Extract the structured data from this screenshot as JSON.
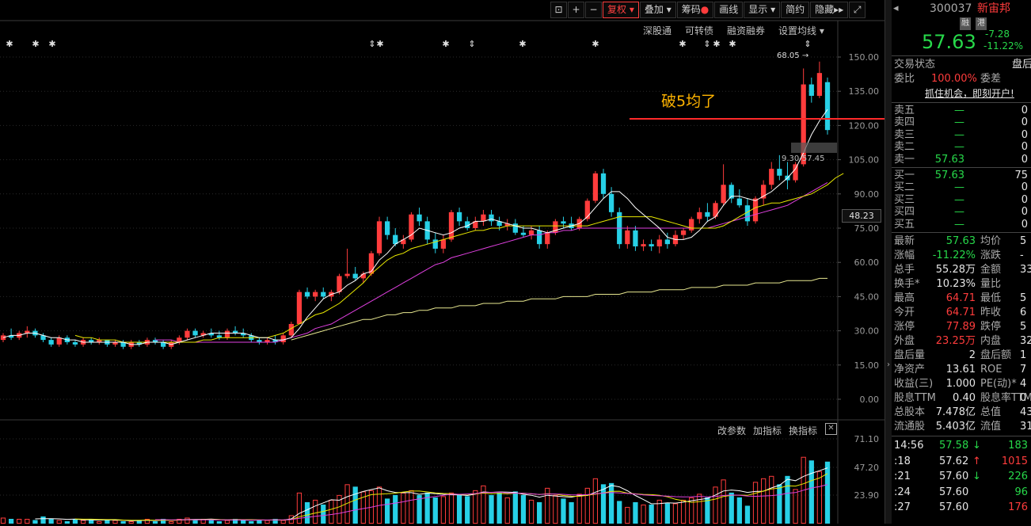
{
  "toolbar": {
    "fuquan": "复权",
    "diejia": "叠加",
    "chouma": "筹码",
    "huaxian": "画线",
    "xianshi": "显示",
    "jianyue": "简约",
    "yincang": "隐藏"
  },
  "subbar": {
    "a": "深股通",
    "b": "可转债",
    "c": "融资融券",
    "d": "设置均线"
  },
  "indicator_bar": {
    "a": "改参数",
    "b": "加指标",
    "c": "换指标"
  },
  "annotation": "破5均了",
  "max_label": "68.05",
  "ma_label": "9.30-57.45",
  "current_price_tag": "48.23",
  "price_axis": [
    "150.00",
    "135.00",
    "120.00",
    "105.00",
    "90.00",
    "75.00",
    "60.00",
    "45.00",
    "30.00",
    "15.00",
    "0.00"
  ],
  "volume_axis": [
    "71.10",
    "47.20",
    "23.90"
  ],
  "stock": {
    "code": "300037",
    "name": "新宙邦",
    "badge1": "融",
    "badge2": "港",
    "price": "57.63",
    "change": "-7.28",
    "change_pct": "-11.22%"
  },
  "status": {
    "label": "交易状态",
    "value": "盘后"
  },
  "weibi": {
    "label": "委比",
    "value": "100.00%",
    "label2": "委差"
  },
  "promo": "抓住机会，即刻开户!",
  "asks": [
    {
      "label": "卖五",
      "price": "—",
      "vol": "0"
    },
    {
      "label": "卖四",
      "price": "—",
      "vol": "0"
    },
    {
      "label": "卖三",
      "price": "—",
      "vol": "0"
    },
    {
      "label": "卖二",
      "price": "—",
      "vol": "0"
    },
    {
      "label": "卖一",
      "price": "57.63",
      "vol": "0"
    }
  ],
  "bids": [
    {
      "label": "买一",
      "price": "57.63",
      "vol": "75"
    },
    {
      "label": "买二",
      "price": "—",
      "vol": "0"
    },
    {
      "label": "买三",
      "price": "—",
      "vol": "0"
    },
    {
      "label": "买四",
      "price": "—",
      "vol": "0"
    },
    {
      "label": "买五",
      "price": "—",
      "vol": "0"
    }
  ],
  "stats": [
    {
      "l1": "最新",
      "v1": "57.63",
      "c1": "green",
      "l2": "均价",
      "v2": "5"
    },
    {
      "l1": "涨幅",
      "v1": "-11.22%",
      "c1": "green",
      "l2": "涨跌",
      "v2": "-"
    },
    {
      "l1": "总手",
      "v1": "55.28万",
      "c1": "white",
      "l2": "金额",
      "v2": "33"
    },
    {
      "l1": "换手*",
      "v1": "10.23%",
      "c1": "white",
      "l2": "量比",
      "v2": ""
    },
    {
      "l1": "最高",
      "v1": "64.71",
      "c1": "red",
      "l2": "最低",
      "v2": "5"
    },
    {
      "l1": "今开",
      "v1": "64.71",
      "c1": "red",
      "l2": "昨收",
      "v2": "6"
    },
    {
      "l1": "涨停",
      "v1": "77.89",
      "c1": "red",
      "l2": "跌停",
      "v2": "5"
    },
    {
      "l1": "外盘",
      "v1": "23.25万",
      "c1": "red",
      "l2": "内盘",
      "v2": "32"
    },
    {
      "l1": "盘后量",
      "v1": "2",
      "c1": "white",
      "l2": "盘后额",
      "v2": "1"
    },
    {
      "l1": "净资产",
      "v1": "13.61",
      "c1": "white",
      "l2": "ROE",
      "v2": "7"
    },
    {
      "l1": "收益(三)",
      "v1": "1.000",
      "c1": "white",
      "l2": "PE(动)*",
      "v2": "4"
    },
    {
      "l1": "股息TTM",
      "v1": "0.40",
      "c1": "white",
      "l2": "股息率TTM",
      "v2": "0"
    },
    {
      "l1": "总股本",
      "v1": "7.478亿",
      "c1": "white",
      "l2": "总值",
      "v2": "43"
    },
    {
      "l1": "流通股",
      "v1": "5.403亿",
      "c1": "white",
      "l2": "流值",
      "v2": "31"
    }
  ],
  "ticks": [
    {
      "time": "14:56",
      "price": "57.58",
      "dir": "↓",
      "vol": "183",
      "pc": "green",
      "vc": "green"
    },
    {
      "time": ":18",
      "price": "57.62",
      "dir": "↑",
      "vol": "1015",
      "pc": "white",
      "vc": "red"
    },
    {
      "time": ":21",
      "price": "57.60",
      "dir": "↓",
      "vol": "226",
      "pc": "white",
      "vc": "green"
    },
    {
      "time": ":24",
      "price": "57.60",
      "dir": "",
      "vol": "96",
      "pc": "white",
      "vc": "green"
    },
    {
      "time": ":27",
      "price": "57.60",
      "dir": "",
      "vol": "176",
      "pc": "white",
      "vc": "red"
    }
  ],
  "colors": {
    "up": "#ff3c3c",
    "down": "#27d0e6",
    "ma5": "#ffffff",
    "ma10": "#e8e800",
    "ma20": "#e040e0",
    "ma250": "#e8e890",
    "accent": "#ffb400"
  },
  "chart_data": {
    "type": "candlestick",
    "price_range": [
      0,
      150
    ],
    "volume_range": [
      0,
      71.1
    ],
    "candles": [
      [
        26,
        29,
        25,
        28
      ],
      [
        28,
        31,
        26,
        27
      ],
      [
        27,
        30,
        26,
        29
      ],
      [
        29,
        32,
        27,
        30
      ],
      [
        30,
        31,
        27,
        28
      ],
      [
        28,
        29,
        25,
        26
      ],
      [
        26,
        27,
        23,
        24
      ],
      [
        24,
        28,
        23,
        27
      ],
      [
        27,
        28,
        24,
        25
      ],
      [
        25,
        26,
        23,
        24
      ],
      [
        24,
        27,
        23,
        26
      ],
      [
        26,
        27,
        24,
        25
      ],
      [
        25,
        27,
        24,
        26
      ],
      [
        26,
        26,
        23,
        24
      ],
      [
        24,
        26,
        23,
        25
      ],
      [
        25,
        26,
        22,
        23
      ],
      [
        23,
        26,
        22,
        25
      ],
      [
        25,
        26,
        23,
        24
      ],
      [
        24,
        27,
        23,
        26
      ],
      [
        26,
        27,
        24,
        25
      ],
      [
        25,
        26,
        22,
        23
      ],
      [
        23,
        26,
        22,
        25
      ],
      [
        25,
        28,
        24,
        27
      ],
      [
        27,
        31,
        26,
        30
      ],
      [
        30,
        31,
        27,
        28
      ],
      [
        28,
        30,
        27,
        29
      ],
      [
        29,
        31,
        27,
        28
      ],
      [
        28,
        30,
        26,
        27
      ],
      [
        27,
        31,
        26,
        30
      ],
      [
        30,
        32,
        28,
        29
      ],
      [
        29,
        31,
        27,
        28
      ],
      [
        28,
        29,
        25,
        26
      ],
      [
        26,
        27,
        24,
        25
      ],
      [
        25,
        27,
        24,
        26
      ],
      [
        26,
        28,
        24,
        25
      ],
      [
        25,
        29,
        24,
        28
      ],
      [
        28,
        34,
        27,
        33
      ],
      [
        33,
        48,
        33,
        47
      ],
      [
        47,
        49,
        44,
        45
      ],
      [
        45,
        48,
        43,
        47
      ],
      [
        47,
        49,
        44,
        45
      ],
      [
        45,
        48,
        43,
        47
      ],
      [
        47,
        55,
        46,
        54
      ],
      [
        54,
        66,
        53,
        55
      ],
      [
        55,
        58,
        52,
        53
      ],
      [
        53,
        56,
        51,
        55
      ],
      [
        55,
        65,
        54,
        64
      ],
      [
        64,
        80,
        63,
        78
      ],
      [
        78,
        80,
        70,
        72
      ],
      [
        72,
        75,
        67,
        68
      ],
      [
        68,
        72,
        66,
        70
      ],
      [
        70,
        82,
        69,
        81
      ],
      [
        81,
        84,
        76,
        78
      ],
      [
        78,
        80,
        68,
        70
      ],
      [
        70,
        73,
        64,
        66
      ],
      [
        66,
        72,
        64,
        70
      ],
      [
        70,
        83,
        69,
        82
      ],
      [
        82,
        84,
        76,
        78
      ],
      [
        78,
        80,
        74,
        75
      ],
      [
        75,
        80,
        74,
        78
      ],
      [
        78,
        83,
        76,
        81
      ],
      [
        81,
        83,
        76,
        78
      ],
      [
        78,
        80,
        74,
        76
      ],
      [
        76,
        79,
        74,
        77
      ],
      [
        77,
        79,
        72,
        73
      ],
      [
        73,
        76,
        71,
        72
      ],
      [
        72,
        76,
        70,
        74
      ],
      [
        74,
        76,
        66,
        68
      ],
      [
        68,
        74,
        66,
        73
      ],
      [
        73,
        79,
        72,
        78
      ],
      [
        78,
        80,
        75,
        77
      ],
      [
        77,
        80,
        74,
        75
      ],
      [
        75,
        80,
        74,
        79
      ],
      [
        79,
        88,
        78,
        87
      ],
      [
        87,
        100,
        86,
        99
      ],
      [
        99,
        101,
        88,
        90
      ],
      [
        90,
        93,
        80,
        82
      ],
      [
        82,
        84,
        66,
        68
      ],
      [
        68,
        76,
        66,
        74
      ],
      [
        74,
        76,
        65,
        67
      ],
      [
        67,
        70,
        65,
        68
      ],
      [
        68,
        70,
        65,
        67
      ],
      [
        67,
        72,
        64,
        70
      ],
      [
        70,
        73,
        66,
        68
      ],
      [
        68,
        74,
        67,
        72
      ],
      [
        72,
        75,
        70,
        74
      ],
      [
        74,
        80,
        73,
        79
      ],
      [
        79,
        84,
        77,
        82
      ],
      [
        82,
        86,
        78,
        80
      ],
      [
        80,
        87,
        79,
        86
      ],
      [
        86,
        103,
        85,
        94
      ],
      [
        94,
        95,
        86,
        88
      ],
      [
        88,
        92,
        84,
        85
      ],
      [
        85,
        88,
        76,
        78
      ],
      [
        78,
        89,
        77,
        88
      ],
      [
        88,
        96,
        85,
        94
      ],
      [
        94,
        104,
        92,
        101
      ],
      [
        101,
        107,
        96,
        98
      ],
      [
        98,
        104,
        92,
        96
      ],
      [
        96,
        104,
        95,
        103
      ],
      [
        103,
        145,
        102,
        138
      ],
      [
        138,
        141,
        130,
        133
      ],
      [
        133,
        148,
        132,
        143
      ],
      [
        139,
        141,
        116,
        118
      ]
    ],
    "volume": [
      5,
      4,
      4,
      4,
      3,
      6,
      4,
      3,
      2,
      4,
      3,
      4,
      2,
      3,
      3,
      2,
      2,
      3,
      4,
      2,
      4,
      2,
      4,
      5,
      3,
      4,
      3,
      2,
      3,
      4,
      3,
      2,
      3,
      3,
      4,
      3,
      7,
      26,
      18,
      20,
      16,
      20,
      24,
      33,
      31,
      27,
      28,
      31,
      21,
      24,
      26,
      28,
      24,
      26,
      22,
      23,
      26,
      24,
      23,
      28,
      32,
      24,
      26,
      22,
      27,
      24,
      20,
      18,
      30,
      24,
      21,
      18,
      25,
      30,
      38,
      33,
      34,
      19,
      14,
      18,
      16,
      16,
      20,
      17,
      17,
      20,
      22,
      25,
      22,
      31,
      37,
      26,
      22,
      15,
      35,
      38,
      40,
      33,
      40,
      29,
      56,
      53,
      44,
      52
    ],
    "ma": {
      "ma5": {
        "start": 0,
        "values": [
          27,
          28,
          28,
          29,
          29,
          28,
          27,
          27,
          26,
          26,
          25,
          25,
          25,
          25,
          25,
          25,
          24,
          24,
          25,
          25,
          25,
          24,
          25,
          26,
          27,
          28,
          29,
          29,
          29,
          29,
          29,
          28,
          27,
          27,
          26,
          26,
          27,
          31,
          36,
          40,
          44,
          46,
          47,
          50,
          52,
          55,
          56,
          61,
          64,
          68,
          70,
          72,
          75,
          74,
          73,
          72,
          73,
          75,
          76,
          78,
          78,
          79,
          78,
          77,
          76,
          75,
          75,
          74,
          73,
          74,
          75,
          76,
          77,
          80,
          84,
          88,
          91,
          91,
          88,
          84,
          81,
          78,
          75,
          71,
          70,
          70,
          71,
          74,
          78,
          80,
          85,
          89,
          89,
          88,
          87,
          89,
          91,
          94,
          97,
          101,
          108,
          116,
          122,
          127
        ]
      },
      "ma10": {
        "start": 9,
        "values": [
          28,
          27,
          27,
          26,
          26,
          26,
          25,
          25,
          25,
          25,
          25,
          25,
          25,
          25,
          25,
          25,
          26,
          26,
          27,
          27,
          27,
          27,
          27,
          27,
          27,
          28,
          29,
          31,
          33,
          35,
          37,
          38,
          40,
          42,
          45,
          48,
          51,
          55,
          58,
          61,
          63,
          64,
          66,
          67,
          68,
          69,
          70,
          71,
          72,
          73,
          74,
          74,
          75,
          75,
          76,
          76,
          76,
          76,
          76,
          76,
          76,
          76,
          76,
          76,
          76,
          77,
          78,
          79,
          80,
          80,
          80,
          80,
          80,
          79,
          78,
          77,
          76,
          75,
          75,
          75,
          75,
          76,
          78,
          80,
          82,
          84,
          85,
          86,
          86,
          87,
          88,
          89,
          90,
          92,
          94,
          97,
          99
        ]
      },
      "ma20": {
        "start": 19,
        "values": [
          26,
          26,
          26,
          25,
          25,
          25,
          25,
          25,
          25,
          25,
          25,
          25,
          25,
          25,
          25,
          25,
          26,
          27,
          28,
          29,
          31,
          32,
          33,
          35,
          37,
          39,
          41,
          43,
          45,
          47,
          49,
          51,
          53,
          55,
          57,
          59,
          60,
          62,
          63,
          64,
          65,
          66,
          67,
          68,
          69,
          70,
          71,
          72,
          72,
          73,
          73,
          74,
          74,
          75,
          75,
          75,
          75,
          75,
          75,
          75,
          75,
          75,
          75,
          75,
          75,
          75,
          75,
          75,
          75,
          75,
          76,
          77,
          78,
          79,
          80,
          81,
          82,
          83,
          84,
          85,
          87,
          89,
          91,
          93,
          95
        ]
      },
      "ma250": {
        "start": 36,
        "values": [
          26,
          27,
          28,
          29,
          30,
          31,
          32,
          33,
          34,
          35,
          35,
          36,
          37,
          37,
          38,
          38,
          39,
          39,
          40,
          40,
          40,
          41,
          41,
          41,
          42,
          42,
          42,
          43,
          43,
          43,
          44,
          44,
          44,
          44,
          45,
          45,
          45,
          45,
          46,
          46,
          46,
          46,
          47,
          47,
          47,
          47,
          48,
          48,
          48,
          48,
          49,
          49,
          49,
          49,
          50,
          50,
          50,
          50,
          51,
          51,
          51,
          51,
          52,
          52,
          52,
          52,
          53,
          53
        ]
      }
    }
  }
}
